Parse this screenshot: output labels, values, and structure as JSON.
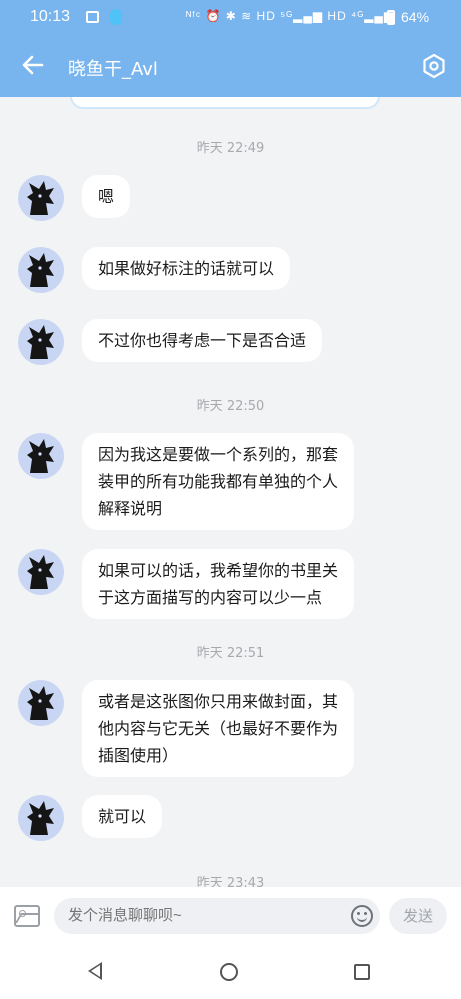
{
  "status_bar": {
    "time": "10:13",
    "indicators": "ᴺᶠᶜ ⏰ ✱ ≋ HD ⁵ᴳ▂▄▆ HD ⁴ᴳ▂▄▆",
    "battery": "64%"
  },
  "header": {
    "title": "晓鱼干_Avl",
    "back_icon": "arrow-left-icon",
    "settings_icon": "settings-hexagon-icon"
  },
  "timestamps": [
    "昨天 22:49",
    "昨天 22:50",
    "昨天 22:51",
    "昨天 23:43"
  ],
  "messages": [
    {
      "lines": [
        "嗯"
      ]
    },
    {
      "lines": [
        "如果做好标注的话就可以"
      ]
    },
    {
      "lines": [
        "不过你也得考虑一下是否合适"
      ]
    },
    {
      "lines": [
        "因为我这是要做一个系列的，那套",
        "装甲的所有功能我都有单独的个人",
        "解释说明"
      ]
    },
    {
      "lines": [
        "如果可以的话，我希望你的书里关",
        "于这方面描写的内容可以少一点"
      ]
    },
    {
      "lines": [
        "或者是这张图你只用来做封面，其",
        "他内容与它无关（也最好不要作为",
        "插图使用）"
      ]
    },
    {
      "lines": [
        "就可以"
      ]
    }
  ],
  "input_bar": {
    "placeholder": "发个消息聊聊呗~",
    "send_label": "发送"
  },
  "colors": {
    "header": "#78b4ee",
    "background": "#f2f3f5",
    "bubble": "#ffffff"
  }
}
